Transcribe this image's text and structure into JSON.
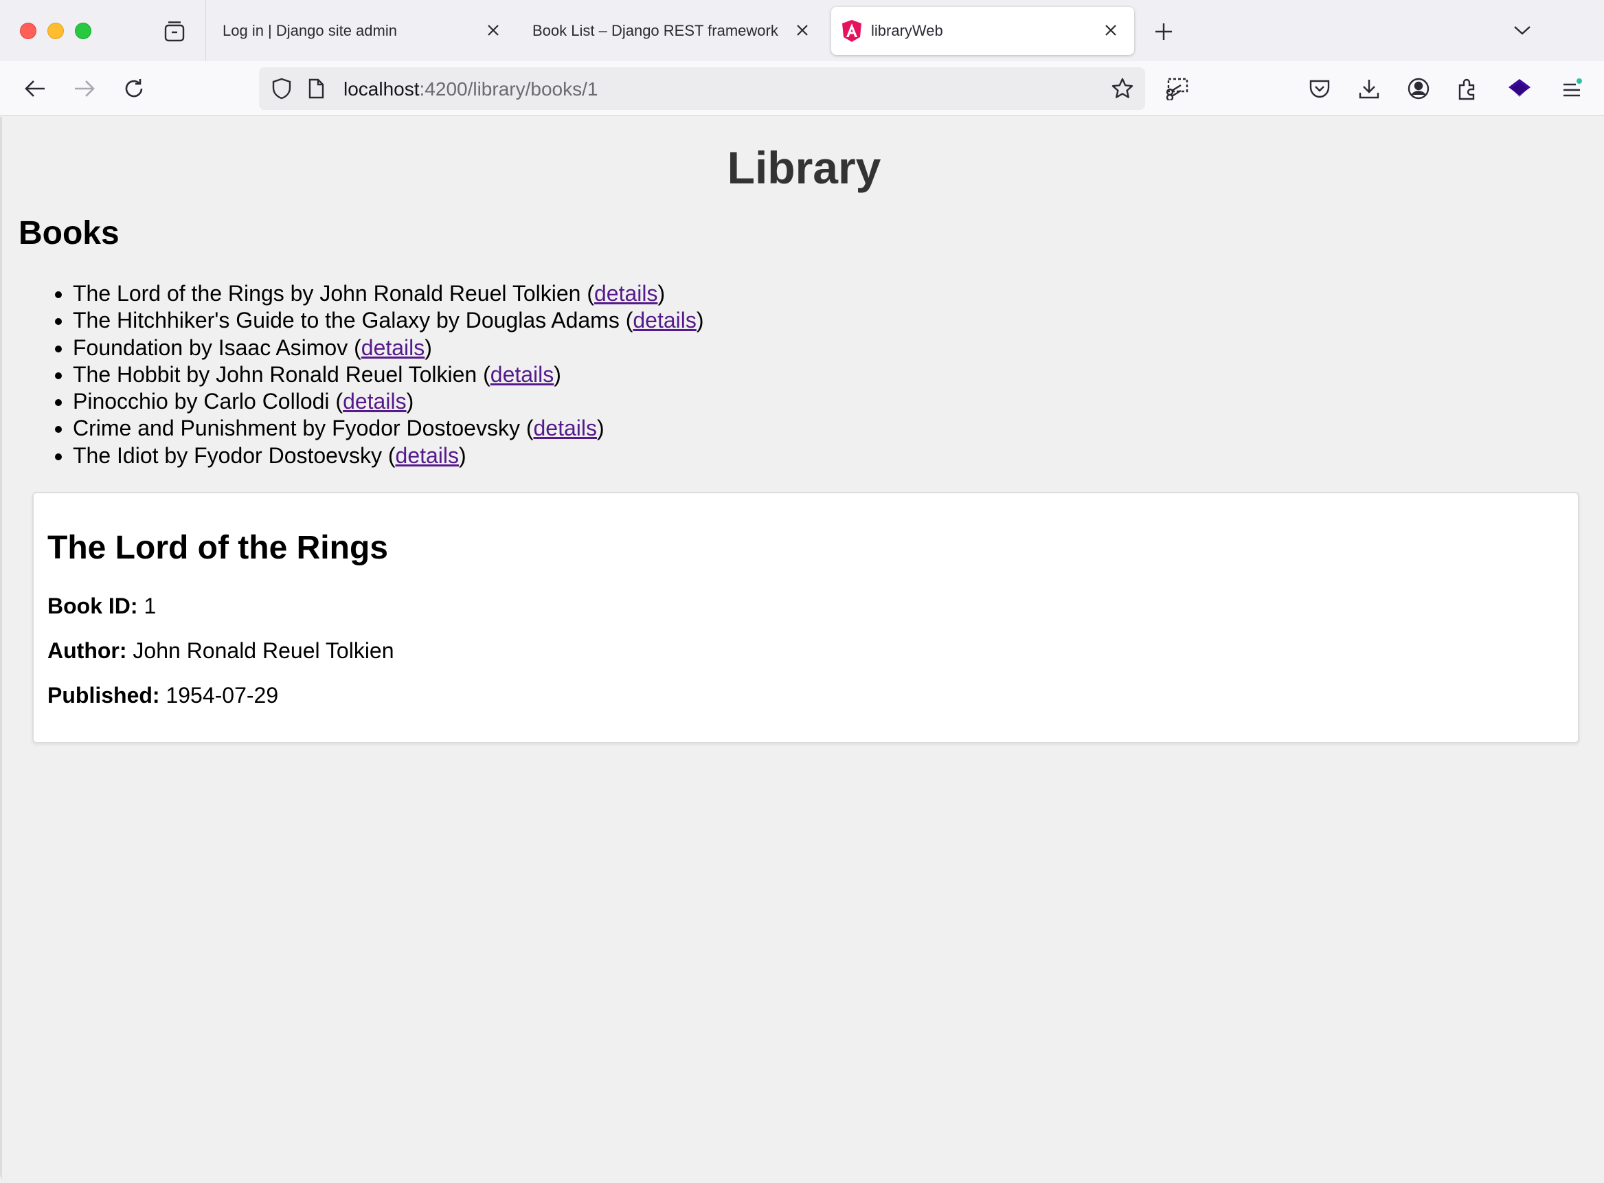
{
  "browser": {
    "tabs": [
      {
        "label": "Log in | Django site admin",
        "active": false
      },
      {
        "label": "Book List – Django REST framework",
        "active": false
      },
      {
        "label": "libraryWeb",
        "active": true
      }
    ],
    "url": {
      "host": "localhost",
      "rest": ":4200/library/books/1"
    },
    "icons": {
      "back": "back-arrow-icon",
      "forward": "forward-arrow-icon",
      "reload": "reload-icon",
      "tracking": "shield-icon",
      "page": "page-icon",
      "bookmark": "star-icon",
      "screenshot": "screenshot-icon",
      "pocket": "pocket-icon",
      "downloads": "download-icon",
      "account": "account-icon",
      "extensions": "extensions-icon",
      "extension": "stack-extension-icon",
      "menu": "menu-icon"
    },
    "colors": {
      "angular_favicon": "#e5135d",
      "extension": "#3d0a9e",
      "menu_dot": "#2ac3a2"
    }
  },
  "page": {
    "site_title": "Library",
    "list_title": "Books",
    "details_link": "details",
    "books": [
      {
        "text": "The Lord of the Rings by John Ronald Reuel Tolkien"
      },
      {
        "text": "The Hitchhiker's Guide to the Galaxy by Douglas Adams"
      },
      {
        "text": "Foundation by Isaac Asimov"
      },
      {
        "text": "The Hobbit by John Ronald Reuel Tolkien"
      },
      {
        "text": "Pinocchio by Carlo Collodi"
      },
      {
        "text": "Crime and Punishment by Fyodor Dostoevsky"
      },
      {
        "text": "The Idiot by Fyodor Dostoevsky"
      }
    ],
    "detail": {
      "title": "The Lord of the Rings",
      "id_label": "Book ID:",
      "id_value": "1",
      "author_label": "Author:",
      "author_value": "John Ronald Reuel Tolkien",
      "published_label": "Published:",
      "published_value": "1954-07-29"
    }
  }
}
